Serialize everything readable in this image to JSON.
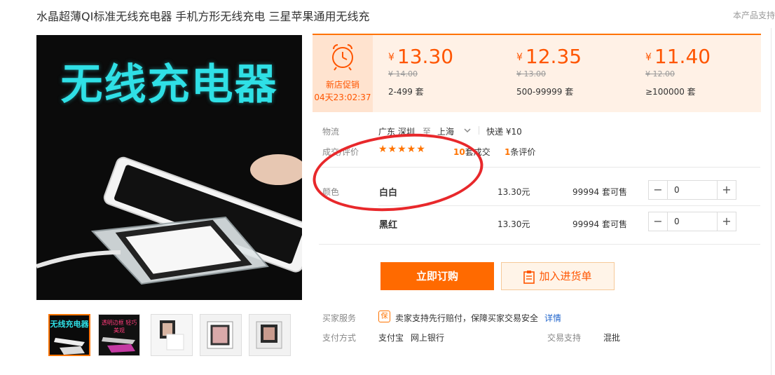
{
  "product": {
    "title": "水晶超薄QI标准无线充电器 手机方形无线充电 三星苹果通用无线充",
    "support_text": "本产品支持",
    "main_image_text": "无线充电器"
  },
  "promo": {
    "label": "新店促销",
    "timer": "04天23:02:37",
    "tiers": [
      {
        "currency": "¥",
        "price": "13.30",
        "old_price": "¥ 14.00",
        "range": "2-499 套"
      },
      {
        "currency": "¥",
        "price": "12.35",
        "old_price": "¥ 13.00",
        "range": "500-99999 套"
      },
      {
        "currency": "¥",
        "price": "11.40",
        "old_price": "¥ 12.00",
        "range": "≥100000 套"
      }
    ]
  },
  "logistics": {
    "label": "物流",
    "from": "广东 深圳",
    "to_word": "至",
    "to": "上海",
    "express": "快递 ¥10"
  },
  "reviews": {
    "label": "成交/评价",
    "deals_count": "10",
    "deals_suffix": "套成交",
    "reviews_count": "1",
    "reviews_suffix": "条评价"
  },
  "variants": {
    "label": "颜色",
    "items": [
      {
        "name": "白白",
        "price": "13.30元",
        "stock": "99994 套可售",
        "qty": "0"
      },
      {
        "name": "黑红",
        "price": "13.30元",
        "stock": "99994 套可售",
        "qty": "0"
      }
    ]
  },
  "actions": {
    "buy_label": "立即订购",
    "cart_label": "加入进货单"
  },
  "services": {
    "label": "买家服务",
    "badge": "保",
    "text": "卖家支持先行赔付，保障买家交易安全",
    "details_link": "详情"
  },
  "payment": {
    "label": "支付方式",
    "methods": [
      "支付宝",
      "网上银行"
    ],
    "trade_label": "交易支持",
    "trade_value": "混批"
  },
  "thumbnails": {
    "labels": [
      "无线充电器",
      "透明边框 轻巧美观"
    ]
  },
  "colors": {
    "accent": "#ff6a00",
    "price": "#ff5500",
    "annotation": "#e8282b"
  }
}
